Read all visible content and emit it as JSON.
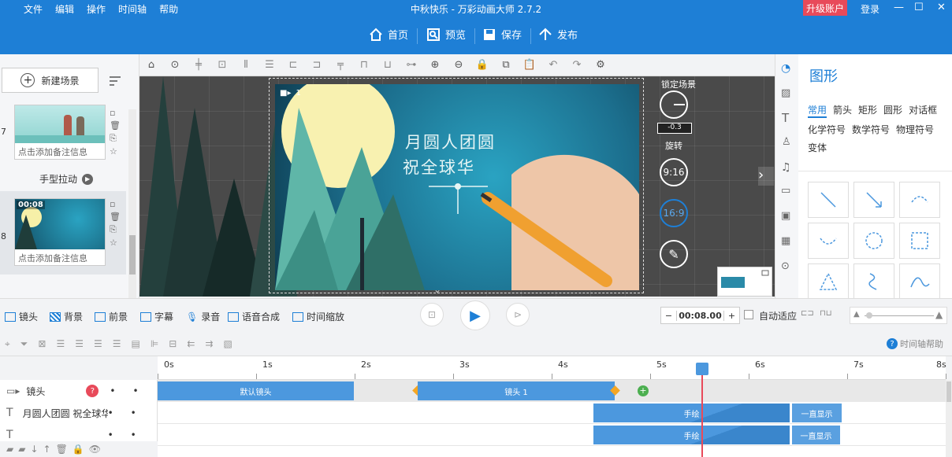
{
  "menu": [
    "文件",
    "编辑",
    "操作",
    "时间轴",
    "帮助"
  ],
  "app_title": "中秋快乐 - 万彩动画大师 2.7.2",
  "upgrade_label": "升级账户",
  "login_label": "登录",
  "toolbar": {
    "home": "首页",
    "preview": "预览",
    "save": "保存",
    "publish": "发布"
  },
  "left": {
    "new_scene": "新建场景",
    "scenes": [
      {
        "num": "7",
        "note": "点击添加备注信息",
        "transition": "手型拉动"
      },
      {
        "num": "8",
        "note": "点击添加备注信息",
        "time": "00:08"
      }
    ]
  },
  "stage": {
    "art_title_1": "月圆人团圆",
    "art_title_2": "祝全球华",
    "camera_label": "1",
    "lock_label": "锁定场景",
    "rotate_value": "-0.3",
    "rotate_label": "旋转",
    "ratio_916": "9:16",
    "ratio_169": "16:9"
  },
  "right": {
    "title": "图形",
    "categories": [
      "常用",
      "箭头",
      "矩形",
      "圆形",
      "对话框",
      "化学符号",
      "数学符号",
      "物理符号",
      "变体"
    ],
    "active_category": "常用"
  },
  "tracks_bar": {
    "items": [
      "镜头",
      "背景",
      "前景",
      "字幕",
      "录音",
      "语音合成",
      "时间缩放"
    ],
    "time": "00:08.00",
    "auto_fit": "自动适应",
    "help": "时间轴帮助"
  },
  "ruler": [
    "0s",
    "1s",
    "2s",
    "3s",
    "4s",
    "5s",
    "6s",
    "7s",
    "8s"
  ],
  "timeline": {
    "rows": [
      {
        "name": "镜头",
        "clips": [
          {
            "label": "默认镜头"
          },
          {
            "label": "镜头 1"
          }
        ]
      },
      {
        "name": "月圆人团圆 祝全球华",
        "clips": [
          {
            "label": "手绘"
          },
          {
            "label": "一直显示"
          }
        ]
      },
      {
        "name": "",
        "clips": [
          {
            "label": "手绘"
          },
          {
            "label": "一直显示"
          }
        ]
      }
    ]
  },
  "colors": {
    "brand": "#1e7fd6",
    "upgrade": "#e84a5a",
    "clip": "#4c98de"
  }
}
